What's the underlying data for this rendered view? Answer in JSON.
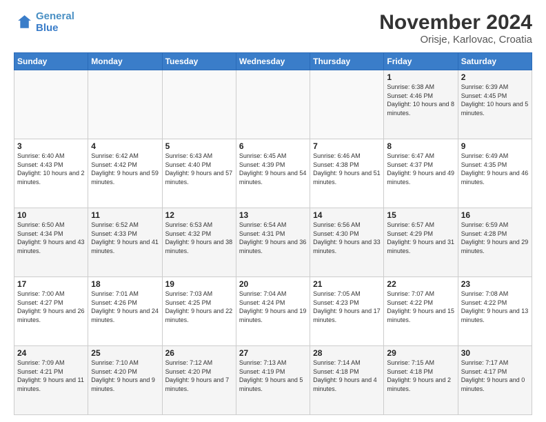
{
  "header": {
    "logo_line1": "General",
    "logo_line2": "Blue",
    "title": "November 2024",
    "subtitle": "Orisje, Karlovac, Croatia"
  },
  "calendar": {
    "days_of_week": [
      "Sunday",
      "Monday",
      "Tuesday",
      "Wednesday",
      "Thursday",
      "Friday",
      "Saturday"
    ],
    "weeks": [
      [
        {
          "day": "",
          "info": ""
        },
        {
          "day": "",
          "info": ""
        },
        {
          "day": "",
          "info": ""
        },
        {
          "day": "",
          "info": ""
        },
        {
          "day": "",
          "info": ""
        },
        {
          "day": "1",
          "info": "Sunrise: 6:38 AM\nSunset: 4:46 PM\nDaylight: 10 hours and 8 minutes."
        },
        {
          "day": "2",
          "info": "Sunrise: 6:39 AM\nSunset: 4:45 PM\nDaylight: 10 hours and 5 minutes."
        }
      ],
      [
        {
          "day": "3",
          "info": "Sunrise: 6:40 AM\nSunset: 4:43 PM\nDaylight: 10 hours and 2 minutes."
        },
        {
          "day": "4",
          "info": "Sunrise: 6:42 AM\nSunset: 4:42 PM\nDaylight: 9 hours and 59 minutes."
        },
        {
          "day": "5",
          "info": "Sunrise: 6:43 AM\nSunset: 4:40 PM\nDaylight: 9 hours and 57 minutes."
        },
        {
          "day": "6",
          "info": "Sunrise: 6:45 AM\nSunset: 4:39 PM\nDaylight: 9 hours and 54 minutes."
        },
        {
          "day": "7",
          "info": "Sunrise: 6:46 AM\nSunset: 4:38 PM\nDaylight: 9 hours and 51 minutes."
        },
        {
          "day": "8",
          "info": "Sunrise: 6:47 AM\nSunset: 4:37 PM\nDaylight: 9 hours and 49 minutes."
        },
        {
          "day": "9",
          "info": "Sunrise: 6:49 AM\nSunset: 4:35 PM\nDaylight: 9 hours and 46 minutes."
        }
      ],
      [
        {
          "day": "10",
          "info": "Sunrise: 6:50 AM\nSunset: 4:34 PM\nDaylight: 9 hours and 43 minutes."
        },
        {
          "day": "11",
          "info": "Sunrise: 6:52 AM\nSunset: 4:33 PM\nDaylight: 9 hours and 41 minutes."
        },
        {
          "day": "12",
          "info": "Sunrise: 6:53 AM\nSunset: 4:32 PM\nDaylight: 9 hours and 38 minutes."
        },
        {
          "day": "13",
          "info": "Sunrise: 6:54 AM\nSunset: 4:31 PM\nDaylight: 9 hours and 36 minutes."
        },
        {
          "day": "14",
          "info": "Sunrise: 6:56 AM\nSunset: 4:30 PM\nDaylight: 9 hours and 33 minutes."
        },
        {
          "day": "15",
          "info": "Sunrise: 6:57 AM\nSunset: 4:29 PM\nDaylight: 9 hours and 31 minutes."
        },
        {
          "day": "16",
          "info": "Sunrise: 6:59 AM\nSunset: 4:28 PM\nDaylight: 9 hours and 29 minutes."
        }
      ],
      [
        {
          "day": "17",
          "info": "Sunrise: 7:00 AM\nSunset: 4:27 PM\nDaylight: 9 hours and 26 minutes."
        },
        {
          "day": "18",
          "info": "Sunrise: 7:01 AM\nSunset: 4:26 PM\nDaylight: 9 hours and 24 minutes."
        },
        {
          "day": "19",
          "info": "Sunrise: 7:03 AM\nSunset: 4:25 PM\nDaylight: 9 hours and 22 minutes."
        },
        {
          "day": "20",
          "info": "Sunrise: 7:04 AM\nSunset: 4:24 PM\nDaylight: 9 hours and 19 minutes."
        },
        {
          "day": "21",
          "info": "Sunrise: 7:05 AM\nSunset: 4:23 PM\nDaylight: 9 hours and 17 minutes."
        },
        {
          "day": "22",
          "info": "Sunrise: 7:07 AM\nSunset: 4:22 PM\nDaylight: 9 hours and 15 minutes."
        },
        {
          "day": "23",
          "info": "Sunrise: 7:08 AM\nSunset: 4:22 PM\nDaylight: 9 hours and 13 minutes."
        }
      ],
      [
        {
          "day": "24",
          "info": "Sunrise: 7:09 AM\nSunset: 4:21 PM\nDaylight: 9 hours and 11 minutes."
        },
        {
          "day": "25",
          "info": "Sunrise: 7:10 AM\nSunset: 4:20 PM\nDaylight: 9 hours and 9 minutes."
        },
        {
          "day": "26",
          "info": "Sunrise: 7:12 AM\nSunset: 4:20 PM\nDaylight: 9 hours and 7 minutes."
        },
        {
          "day": "27",
          "info": "Sunrise: 7:13 AM\nSunset: 4:19 PM\nDaylight: 9 hours and 5 minutes."
        },
        {
          "day": "28",
          "info": "Sunrise: 7:14 AM\nSunset: 4:18 PM\nDaylight: 9 hours and 4 minutes."
        },
        {
          "day": "29",
          "info": "Sunrise: 7:15 AM\nSunset: 4:18 PM\nDaylight: 9 hours and 2 minutes."
        },
        {
          "day": "30",
          "info": "Sunrise: 7:17 AM\nSunset: 4:17 PM\nDaylight: 9 hours and 0 minutes."
        }
      ]
    ]
  }
}
